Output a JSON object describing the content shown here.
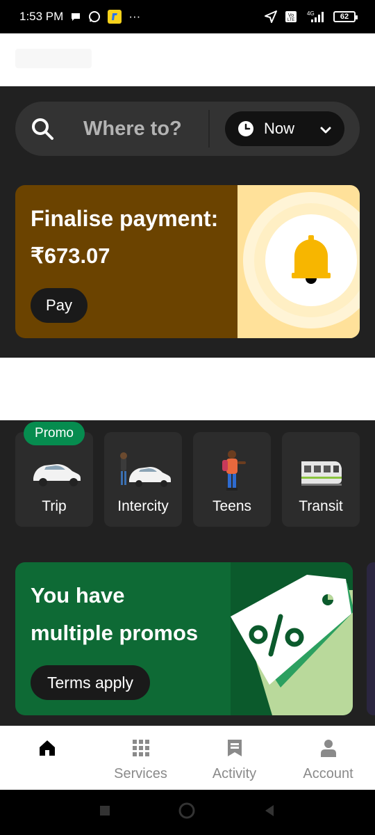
{
  "status_bar": {
    "time": "1:53 PM",
    "more": "···",
    "volte": "Vo LTE",
    "network": "4G",
    "battery": "62"
  },
  "search": {
    "placeholder": "Where to?",
    "time_selector": "Now"
  },
  "payment_card": {
    "title": "Finalise payment:",
    "amount": "₹673.07",
    "button": "Pay"
  },
  "services": [
    {
      "label": "Trip",
      "badge": "Promo"
    },
    {
      "label": "Intercity"
    },
    {
      "label": "Teens"
    },
    {
      "label": "Transit"
    }
  ],
  "promo_card": {
    "line1": "You have",
    "line2": "multiple promos",
    "button": "Terms apply"
  },
  "bottom_nav": [
    {
      "label": "",
      "icon": "home-icon",
      "active": true
    },
    {
      "label": "Services",
      "icon": "grid-icon"
    },
    {
      "label": "Activity",
      "icon": "receipt-icon"
    },
    {
      "label": "Account",
      "icon": "person-icon"
    }
  ],
  "colors": {
    "background": "#212121",
    "payment_card": "#6b4300",
    "promo_card": "#0e6a35",
    "promo_badge": "#068c4f"
  }
}
